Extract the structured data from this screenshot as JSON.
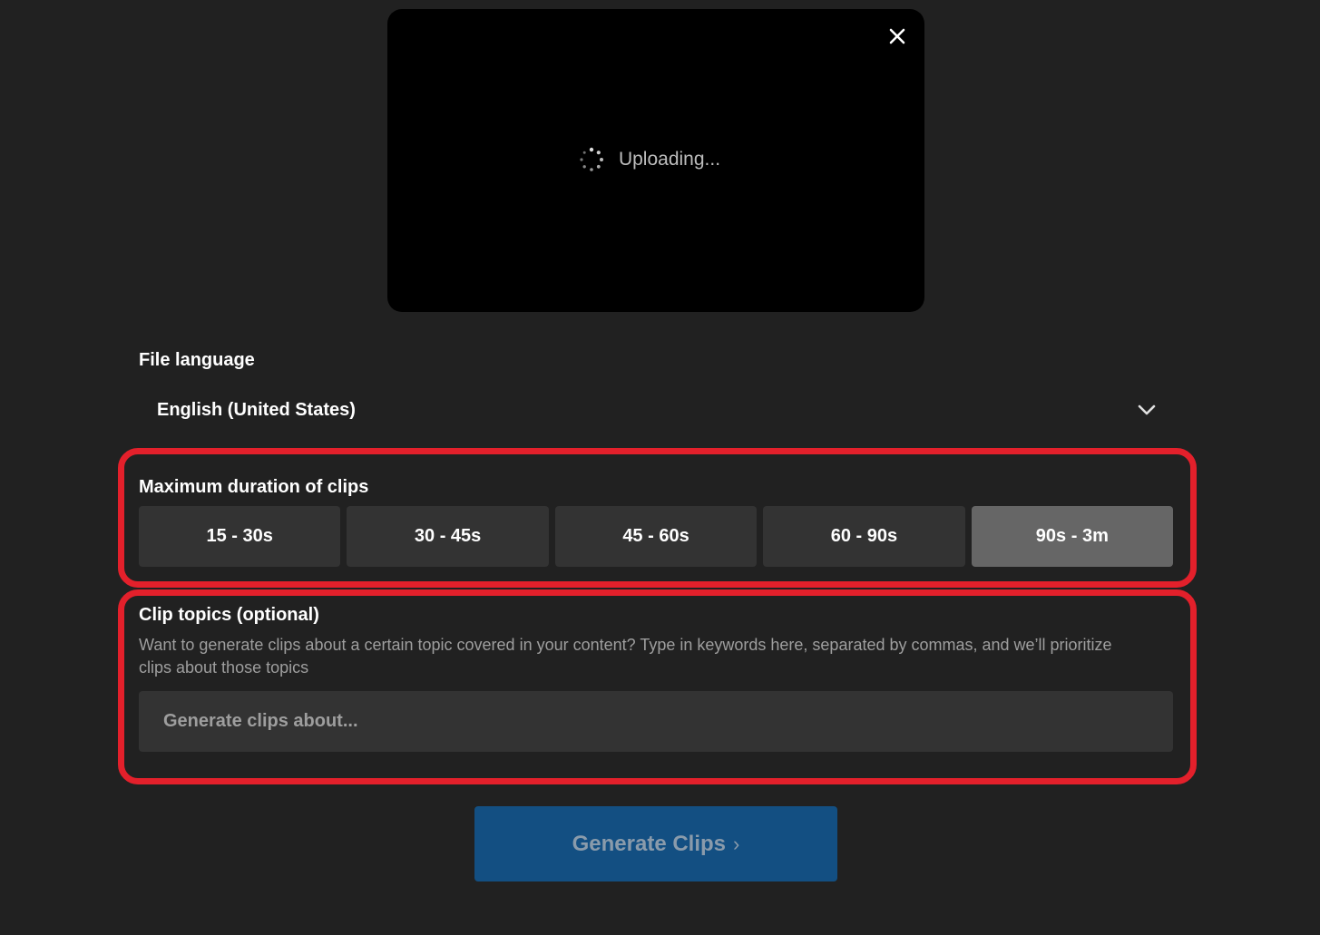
{
  "preview": {
    "status_text": "Uploading...",
    "close_icon": "close-icon",
    "spinner_icon": "spinner-icon"
  },
  "language": {
    "label": "File language",
    "selected": "English (United States)",
    "dropdown_icon": "chevron-down-icon"
  },
  "duration": {
    "label": "Maximum duration of clips",
    "options": [
      "15 - 30s",
      "30 - 45s",
      "45 - 60s",
      "60 - 90s",
      "90s - 3m"
    ],
    "selected": "90s - 3m"
  },
  "topics": {
    "label": "Clip topics (optional)",
    "description": "Want to generate clips about a certain topic covered in your content? Type in keywords here, separated by commas, and we’ll prioritize clips about those topics",
    "placeholder": "Generate clips about...",
    "value": ""
  },
  "generate": {
    "label": "Generate Clips",
    "arrow": "›"
  },
  "colors": {
    "background": "#212121",
    "highlight": "#e3202b",
    "button_primary": "#134f82",
    "option_bg": "#333333",
    "option_selected_bg": "#666666"
  }
}
